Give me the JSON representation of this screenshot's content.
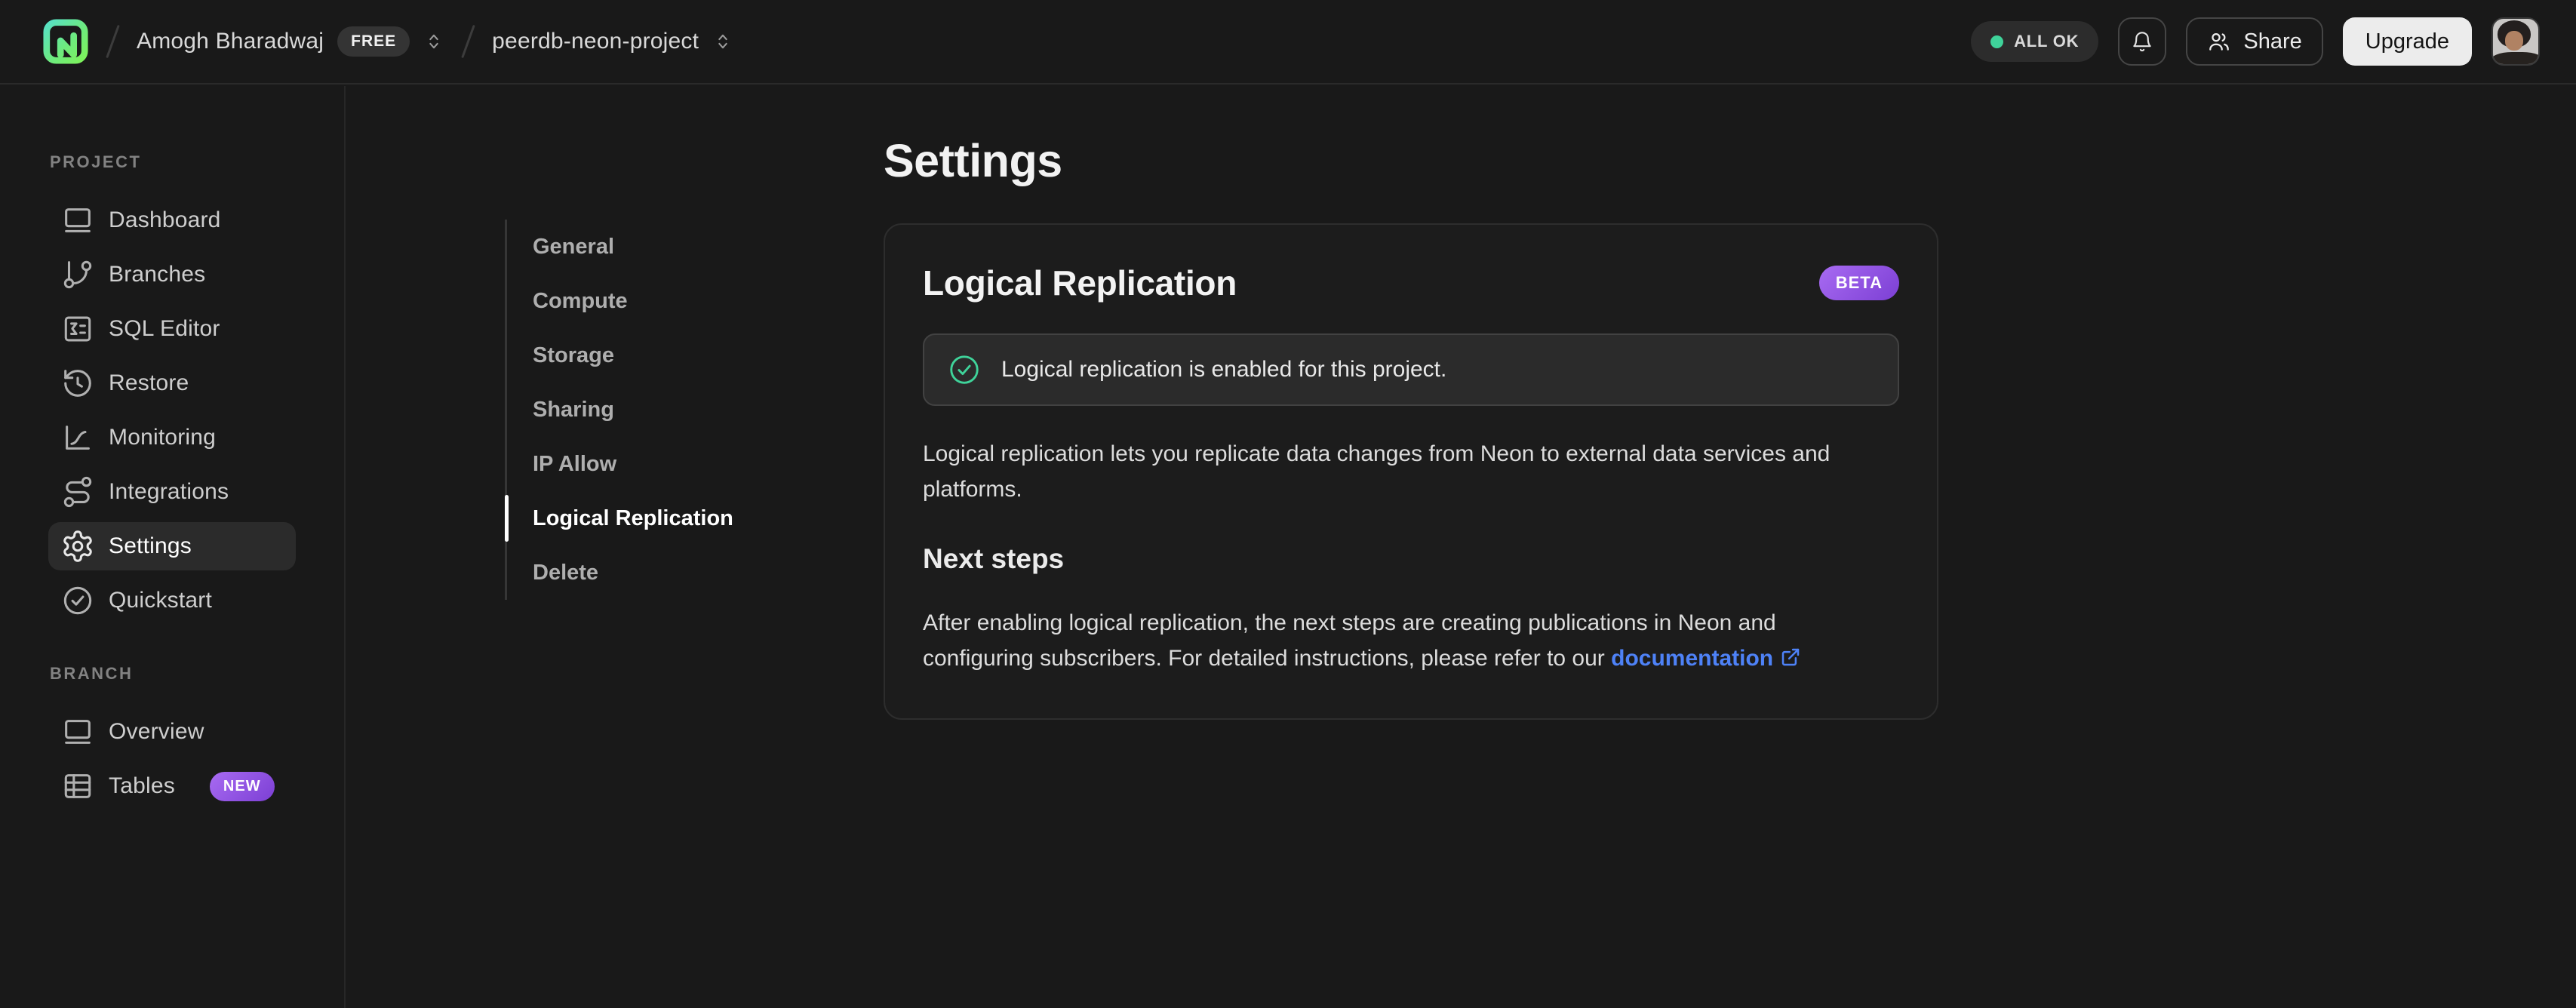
{
  "topbar": {
    "org": {
      "name": "Amogh Bharadwaj",
      "plan_badge": "FREE"
    },
    "project": {
      "name": "peerdb-neon-project"
    },
    "status_label": "ALL OK",
    "share_label": "Share",
    "upgrade_label": "Upgrade"
  },
  "sidebar": {
    "sections": [
      {
        "label": "PROJECT",
        "items": [
          {
            "label": "Dashboard"
          },
          {
            "label": "Branches"
          },
          {
            "label": "SQL Editor"
          },
          {
            "label": "Restore"
          },
          {
            "label": "Monitoring"
          },
          {
            "label": "Integrations"
          },
          {
            "label": "Settings"
          },
          {
            "label": "Quickstart"
          }
        ]
      },
      {
        "label": "BRANCH",
        "items": [
          {
            "label": "Overview"
          },
          {
            "label": "Tables",
            "badge": "NEW"
          }
        ]
      }
    ]
  },
  "settings_nav": {
    "items": [
      {
        "label": "General"
      },
      {
        "label": "Compute"
      },
      {
        "label": "Storage"
      },
      {
        "label": "Sharing"
      },
      {
        "label": "IP Allow"
      },
      {
        "label": "Logical Replication"
      },
      {
        "label": "Delete"
      }
    ]
  },
  "main": {
    "page_title": "Settings",
    "card": {
      "title": "Logical Replication",
      "badge": "BETA",
      "alert_text": "Logical replication is enabled for this project.",
      "description": "Logical replication lets you replicate data changes from Neon to external data services and platforms.",
      "subheading": "Next steps",
      "next_steps_text": "After enabling logical replication, the next steps are creating publications in Neon and configuring subscribers. For detailed instructions, please refer to our ",
      "link_label": "documentation"
    }
  },
  "colors": {
    "accent_green": "#3fd39a",
    "badge_purple_start": "#a86bf2",
    "badge_purple_end": "#7c3fd4",
    "link_blue": "#4e82f7"
  }
}
